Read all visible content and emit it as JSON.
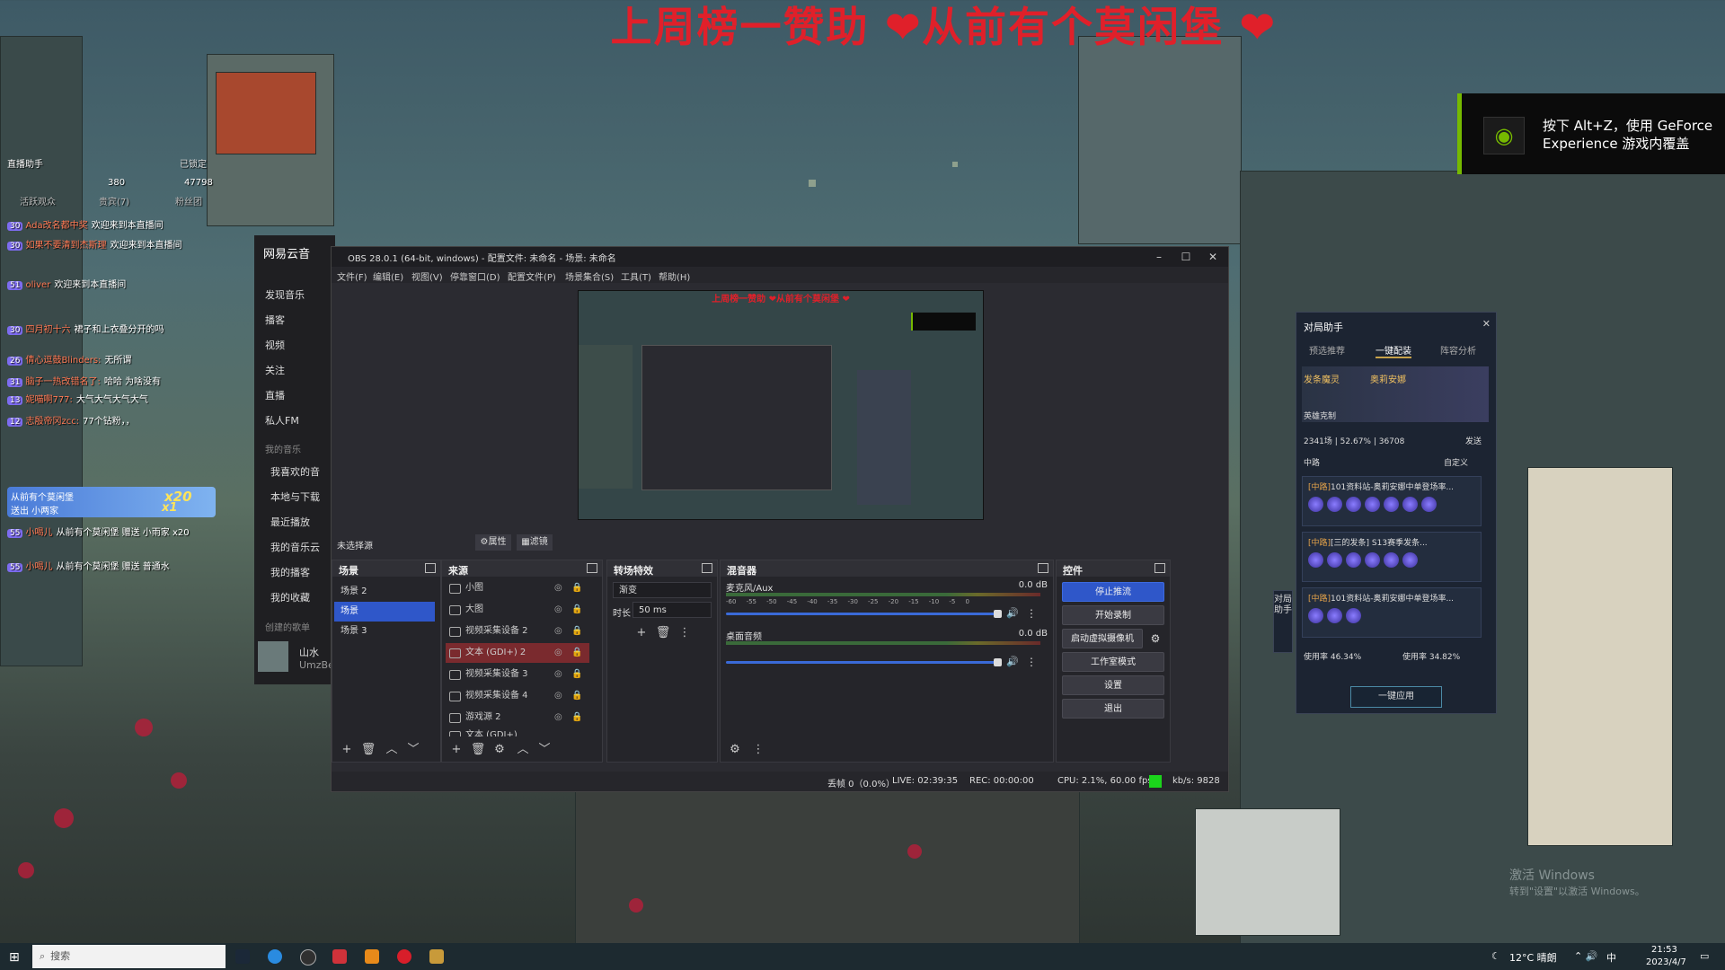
{
  "banner": "上周榜一赞助 ❤从前有个莫闲堡 ❤",
  "geforce": {
    "line1": "按下 Alt+Z，使用 GeForce",
    "line2": "Experience 游戏内覆盖"
  },
  "chat": {
    "header": "直播助手",
    "synced": "已锁定",
    "count_a": "380",
    "count_b": "47798",
    "col1": "活跃观众",
    "col2": "贵宾(7)",
    "col3": "粉丝团",
    "messages": [
      {
        "badge": "30",
        "user": "Ada改名都中奖",
        "text": "欢迎来到本直播间"
      },
      {
        "badge": "30",
        "user": "如果不要清到杰斯理",
        "text": "欢迎来到本直播间"
      },
      {
        "badge": "51",
        "user": "oliver",
        "text": "欢迎来到本直播间"
      },
      {
        "badge": "30",
        "user": "四月初十六",
        "text": "裙子和上衣叠分开的吗"
      },
      {
        "badge": "26",
        "user": "倩心逗鼓Blinders:",
        "text": "无所谓"
      },
      {
        "badge": "31",
        "user": "脑子一热改错名了:",
        "text": "哈哈 为啥没有"
      },
      {
        "badge": "13",
        "user": "妮喵啊777:",
        "text": "大气大气大气大气"
      },
      {
        "badge": "12",
        "user": "志殷帝冈zcc:",
        "text": "77个钻粉，，"
      }
    ],
    "gift_user": "从前有个莫闲堡",
    "gift_text": "送出 小两家",
    "gift_combo": "x20",
    "gift_combo2": "x1",
    "follow_rows": [
      {
        "badge": "55",
        "user": "小喝儿",
        "text": "从前有个莫闲堡 赠送 小雨家 x20"
      },
      {
        "badge": "55",
        "user": "小喝儿",
        "text": "从前有个莫闲堡 赠送 普通水"
      }
    ]
  },
  "netease": {
    "title": "网易云音",
    "items": [
      "发现音乐",
      "播客",
      "视频",
      "关注",
      "直播",
      "私人FM"
    ],
    "section": "我的音乐",
    "my_items": [
      "我喜欢的音",
      "本地与下载",
      "最近播放",
      "我的音乐云",
      "我的播客",
      "我的收藏"
    ],
    "created": "创建的歌单",
    "now_playing": "山水",
    "now_artist": "UmzBe"
  },
  "obs": {
    "title": "OBS 28.0.1 (64-bit, windows) - 配置文件: 未命名 - 场景: 未命名",
    "menu": [
      "文件(F)",
      "编辑(E)",
      "视图(V)",
      "停靠窗口(D)",
      "配置文件(P)",
      "场景集合(S)",
      "工具(T)",
      "帮助(H)"
    ],
    "no_source": "未选择源",
    "props_btn": "属性",
    "filters_btn": "滤镜",
    "docks": {
      "scenes": "场景",
      "sources": "来源",
      "transitions": "转场特效",
      "mixer": "混音器",
      "controls": "控件"
    },
    "scenes": [
      "场景 2",
      "场景",
      "场景 3"
    ],
    "selected_scene": 1,
    "sources": [
      "小图",
      "大图",
      "视频采集设备 2",
      "文本 (GDI+) 2",
      "视频采集设备 3",
      "视频采集设备 4",
      "游戏源 2",
      "文本 (GDI+)"
    ],
    "transition": "渐变",
    "duration_label": "时长",
    "duration": "50 ms",
    "mixer": [
      {
        "name": "麦克风/Aux",
        "db": "0.0 dB"
      },
      {
        "name": "桌面音频",
        "db": "0.0 dB"
      }
    ],
    "scale": [
      "-60",
      "-55",
      "-50",
      "-45",
      "-40",
      "-35",
      "-30",
      "-25",
      "-20",
      "-15",
      "-10",
      "-5",
      "0"
    ],
    "controls": [
      "停止推流",
      "开始录制",
      "启动虚拟摄像机",
      "工作室模式",
      "设置",
      "退出"
    ],
    "status": {
      "dropped": "丢帧 0（0.0%）",
      "live": "LIVE: 02:39:35",
      "rec": "REC: 00:00:00",
      "cpu": "CPU: 2.1%, 60.00 fps",
      "kbps": "kb/s: 9828"
    }
  },
  "helper": {
    "title": "对局助手",
    "tabs": [
      "预选推荐",
      "一键配装",
      "阵容分析"
    ],
    "champ_left": "发条魔灵",
    "champ_right": "奥莉安娜",
    "counter": "英雄克制",
    "stats": "2341场 | 52.67% | 36708",
    "send": "发送",
    "position": "中路",
    "custom": "自定义",
    "cards": [
      {
        "tag": "[中路]",
        "title": "101资料站-奥莉安娜中单登场率..."
      },
      {
        "tag": "[中路]",
        "title": "[三的发条] S13赛季发条..."
      },
      {
        "tag": "[中路]",
        "title": "101资料站-奥莉安娜中单登场率..."
      }
    ],
    "win_a": "使用率 46.34%",
    "win_b": "使用率 34.82%",
    "apply": "一键应用",
    "side_label": "对局助手"
  },
  "taskbar": {
    "search": "搜索",
    "weather": "12°C 晴朗",
    "ime": "中",
    "time": "21:53",
    "date": "2023/4/7"
  },
  "watermark": {
    "line1": "激活 Windows",
    "line2": "转到\"设置\"以激活 Windows。"
  }
}
